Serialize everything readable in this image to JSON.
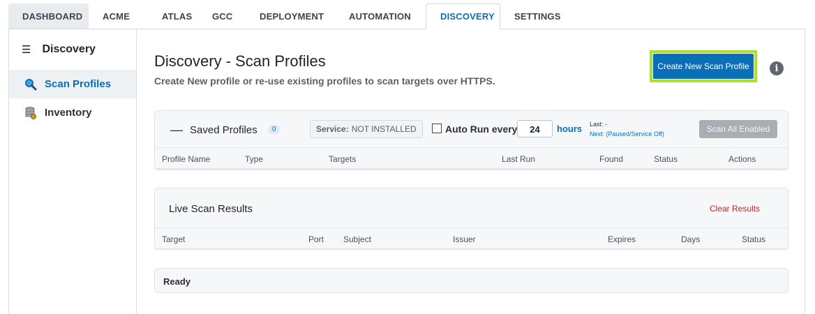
{
  "tabs": [
    {
      "label": "DASHBOARD"
    },
    {
      "label": "ACME"
    },
    {
      "label": "ATLAS"
    },
    {
      "label": "GCC"
    },
    {
      "label": "DEPLOYMENT"
    },
    {
      "label": "AUTOMATION"
    },
    {
      "label": "DISCOVERY",
      "active": true
    },
    {
      "label": "SETTINGS"
    }
  ],
  "sidebar": {
    "title": "Discovery",
    "items": [
      {
        "label": "Scan Profiles",
        "icon": "magnifier-icon",
        "active": true
      },
      {
        "label": "Inventory",
        "icon": "database-icon"
      }
    ]
  },
  "header": {
    "title": "Discovery - Scan Profiles",
    "subtitle": "Create New profile or re-use existing profiles to scan targets over HTTPS.",
    "create_button": "Create New Scan Profile",
    "info_glyph": "i"
  },
  "saved_profiles": {
    "collapse_glyph": "—",
    "title": "Saved Profiles",
    "count": "0",
    "service_label": "Service:",
    "service_value": "NOT INSTALLED",
    "auto_run_label": "Auto Run every",
    "auto_run_checked": false,
    "hours_value": "24",
    "hours_label": "hours",
    "last_text": "Last: -",
    "next_text": "Next: (Paused/Service Off)",
    "scan_all_button": "Scan All Enabled",
    "columns": [
      "Profile Name",
      "Type",
      "Targets",
      "Last Run",
      "Found",
      "Status",
      "Actions"
    ]
  },
  "live_results": {
    "title": "Live Scan Results",
    "clear_button": "Clear Results",
    "columns": [
      "Target",
      "Port",
      "Subject",
      "Issuer",
      "Expires",
      "Days",
      "Status"
    ]
  },
  "status_bar": {
    "text": "Ready"
  },
  "colors": {
    "accent": "#0b6fb8",
    "highlight": "#a6e22e",
    "danger": "#cc1f1f",
    "disabled_button": "#a9aeb4"
  }
}
